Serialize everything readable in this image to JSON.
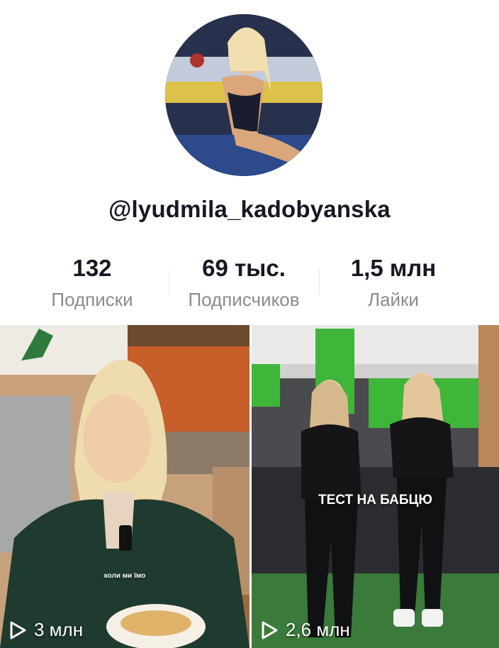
{
  "profile": {
    "username": "@lyudmila_kadobyanska",
    "avatar_icon": "profile-photo"
  },
  "stats": [
    {
      "value": "132",
      "label": "Подписки"
    },
    {
      "value": "69 тыс.",
      "label": "Подписчиков"
    },
    {
      "value": "1,5 млн",
      "label": "Лайки"
    }
  ],
  "videos": [
    {
      "views": "3 млн",
      "caption": "коли ми їмо",
      "icon": "play-icon"
    },
    {
      "views": "2,6 млн",
      "caption": "ТЕСТ НА БАБЦЮ",
      "icon": "play-icon"
    }
  ],
  "colors": {
    "text": "#161823",
    "secondary": "#8a8b91",
    "gym_green": "#3fb53a"
  }
}
